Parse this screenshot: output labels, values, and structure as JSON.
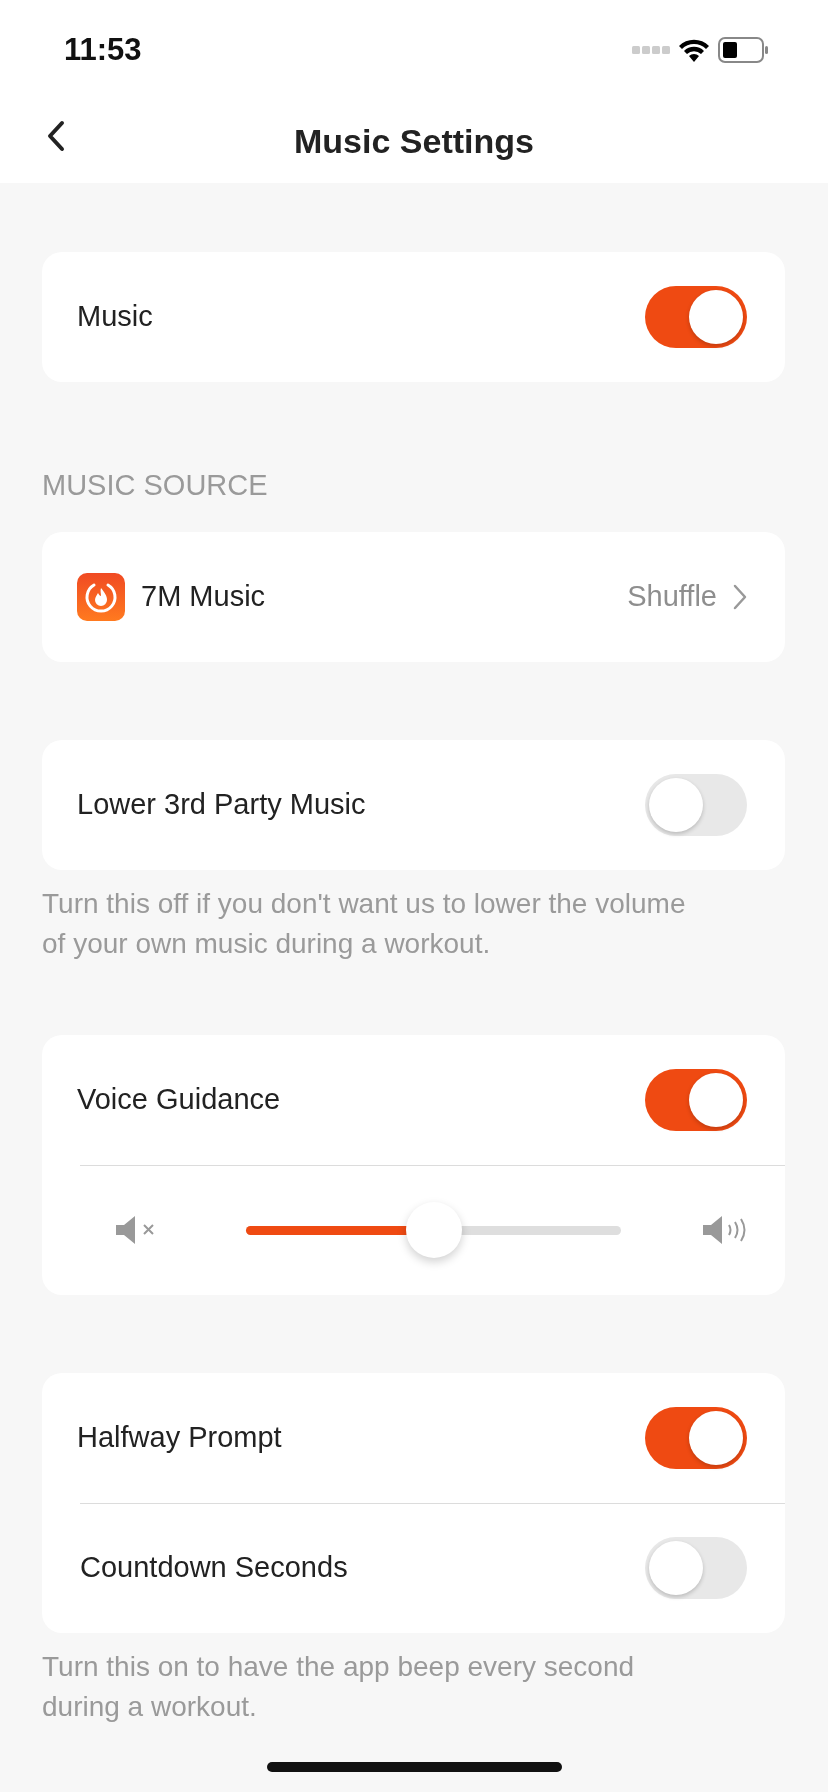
{
  "status_bar": {
    "time": "11:53"
  },
  "header": {
    "title": "Music Settings"
  },
  "sections": [
    {
      "rows": [
        {
          "kind": "toggle",
          "label": "Music",
          "on": true
        }
      ]
    },
    {
      "heading": "MUSIC SOURCE",
      "rows": [
        {
          "kind": "link",
          "label": "7M Music",
          "value": "Shuffle"
        }
      ]
    },
    {
      "rows": [
        {
          "kind": "toggle",
          "label": "Lower 3rd Party Music",
          "on": false
        }
      ],
      "note": "Turn this off if you don't want us to lower the volume of your own music during a workout."
    },
    {
      "rows": [
        {
          "kind": "toggle",
          "label": "Voice Guidance",
          "on": true
        },
        {
          "kind": "slider",
          "level": 0.5
        }
      ]
    },
    {
      "rows": [
        {
          "kind": "toggle",
          "label": "Halfway Prompt",
          "on": true
        },
        {
          "kind": "toggle",
          "label": "Countdown Seconds",
          "on": false
        }
      ],
      "note": "Turn this on to have the app beep every second during a workout."
    }
  ]
}
